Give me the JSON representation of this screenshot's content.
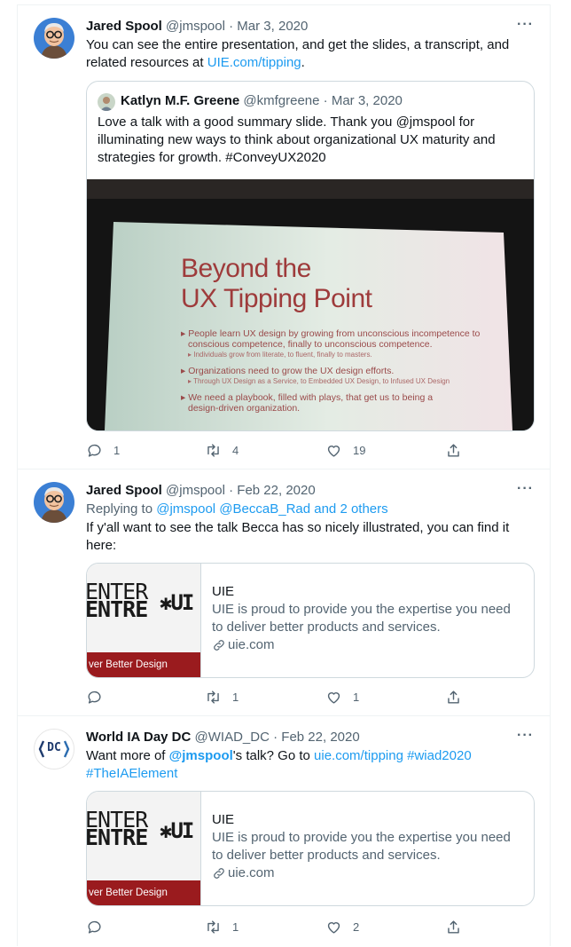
{
  "tweets": [
    {
      "name": "Jared Spool",
      "handle": "@jmspool",
      "date": "Mar 3, 2020",
      "text_1": "You can see the entire presentation, and get the slides, a transcript, and related resources at ",
      "link": "UIE.com/tipping",
      "text_2": ".",
      "quote": {
        "name": "Katlyn M.F. Greene",
        "handle": "@kmfgreene",
        "date": "Mar 3, 2020",
        "text": "Love a talk with a good summary slide. Thank you @jmspool for illuminating new ways to think about organizational UX maturity and strategies for growth. #ConveyUX2020",
        "slide": {
          "title_1": "Beyond the",
          "title_2": "UX Tipping Point",
          "b1": "People learn UX design by growing from unconscious incompetence to",
          "b1b": "conscious competence, finally to unconscious competence.",
          "b1s": "Individuals grow from literate, to fluent, finally to masters.",
          "b2": "Organizations need to grow the UX design efforts.",
          "b2s": "Through UX Design as a Service, to Embedded UX Design, to Infused UX Design",
          "b3": "We need a playbook, filled with plays, that get us to being a",
          "b3b": "design-driven organization."
        }
      },
      "replies": "1",
      "retweets": "4",
      "likes": "19"
    },
    {
      "name": "Jared Spool",
      "handle": "@jmspool",
      "date": "Feb 22, 2020",
      "replying_label": "Replying to ",
      "replying_to": "@jmspool @BeccaB_Rad and 2 others",
      "text": "If y'all want to see the talk Becca has so nicely illustrated, you can find it here:",
      "card": {
        "thumb_line1": "ENTER",
        "thumb_line2": "ENTRE",
        "thumb_mark": "✱UI",
        "thumb_band": "ver Better Design",
        "site": "UIE",
        "description": "UIE is proud to provide you the expertise you need to deliver better products and services.",
        "domain": "uie.com"
      },
      "replies": "",
      "retweets": "1",
      "likes": "1"
    },
    {
      "name": "World IA Day DC",
      "handle": "@WIAD_DC",
      "date": "Feb 22, 2020",
      "text_1": "Want more of ",
      "mention": "@jmspool",
      "text_2": "'s talk? Go to ",
      "link_1": "uie.com/tipping",
      "hashtag_1": "#wiad2020",
      "hashtag_2": "#TheIAElement",
      "avatar_text": "DC",
      "card": {
        "thumb_line1": "ENTER",
        "thumb_line2": "ENTRE",
        "thumb_mark": "✱UI",
        "thumb_band": "ver Better Design",
        "site": "UIE",
        "description": "UIE is proud to provide you the expertise you need to deliver better products and services.",
        "domain": "uie.com"
      },
      "replies": "",
      "retweets": "1",
      "likes": "2"
    }
  ],
  "icons": {
    "more": "more-icon",
    "reply": "reply-icon",
    "retweet": "retweet-icon",
    "like": "like-icon",
    "share": "share-icon",
    "link": "link-icon"
  },
  "more_glyph": "···",
  "colors": {
    "accent": "#1d9bf0",
    "muted": "#536471",
    "text": "#0f1419",
    "border": "#cfd9de"
  }
}
